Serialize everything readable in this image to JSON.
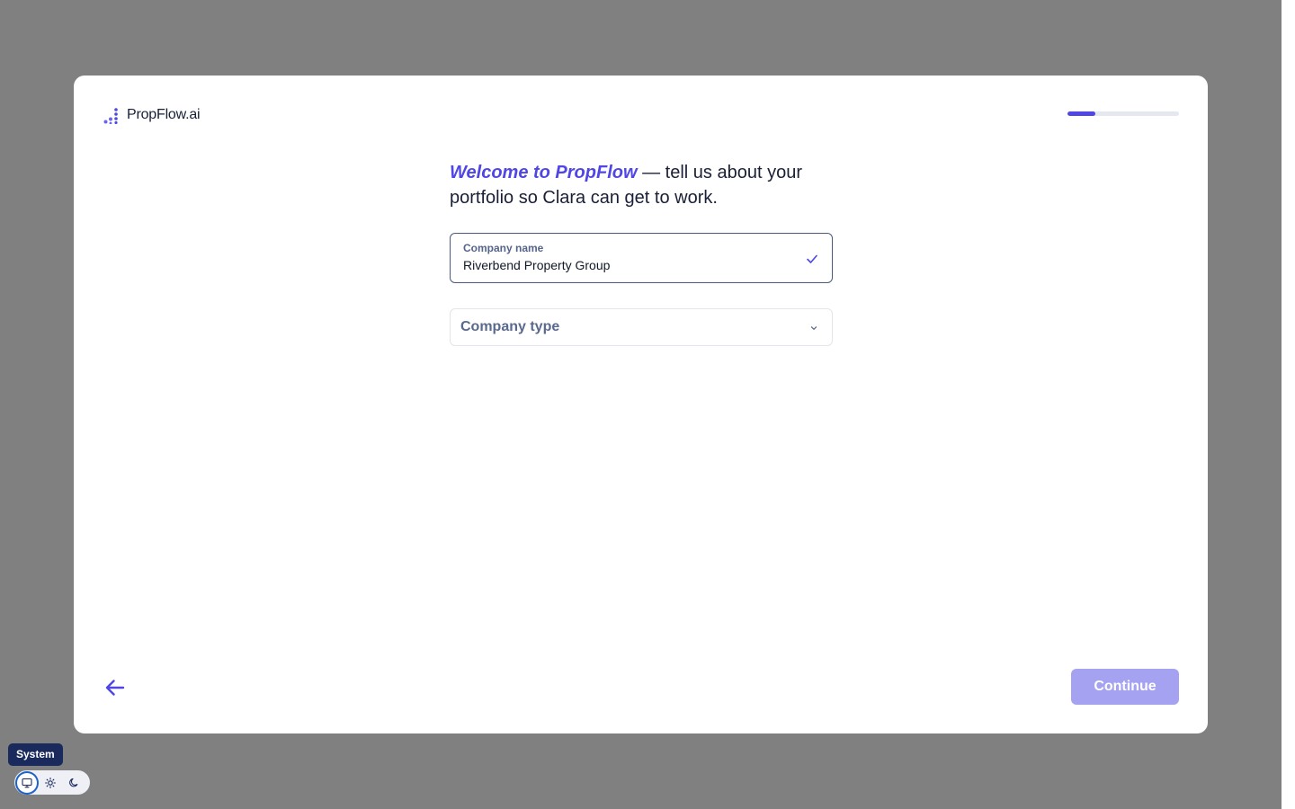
{
  "brand": {
    "name": "PropFlow.ai"
  },
  "progress": {
    "fraction": 0.25
  },
  "heading": {
    "accent": "Welcome to PropFlow",
    "rest": " — tell us about your portfolio so Clara can get to work."
  },
  "company_name_field": {
    "label": "Company name",
    "value": "Riverbend Property Group"
  },
  "company_type_select": {
    "placeholder": "Company type"
  },
  "footer": {
    "continue_label": "Continue"
  },
  "theme_switcher": {
    "tooltip": "System",
    "options": [
      "system",
      "light",
      "dark"
    ],
    "selected": "system"
  },
  "colors": {
    "accent": "#4f46e5",
    "backdrop": "#808080",
    "continue_disabled": "#a5a2f1",
    "tooltip_bg": "#1b2a5c"
  }
}
